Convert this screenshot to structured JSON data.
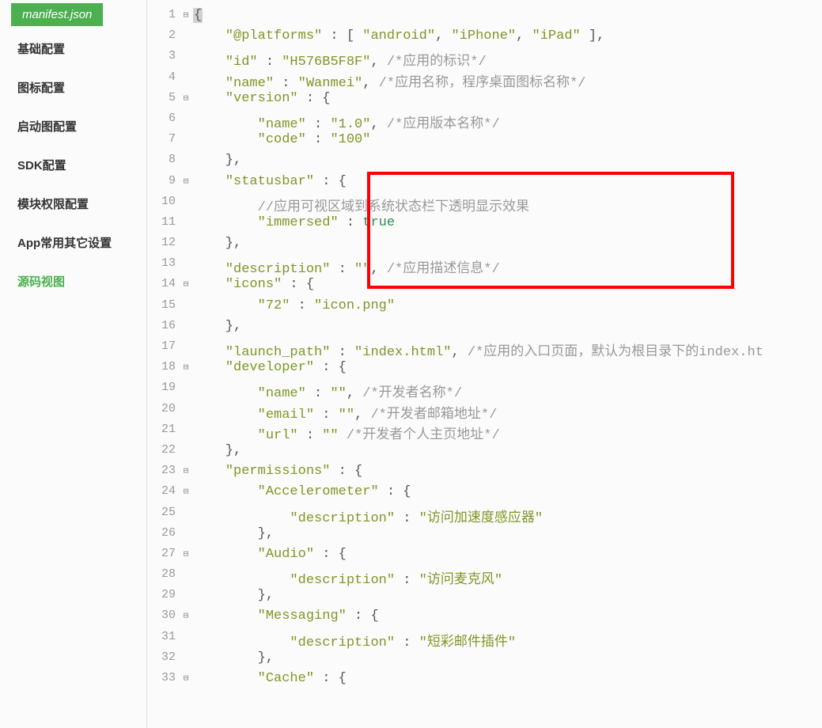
{
  "file_tab": "manifest.json",
  "sidebar": {
    "items": [
      "基础配置",
      "图标配置",
      "启动图配置",
      "SDK配置",
      "模块权限配置",
      "App常用其它设置",
      "源码视图"
    ]
  },
  "code": {
    "lines": [
      {
        "no": 1,
        "fold": "⊟",
        "tokens": [
          {
            "t": "{",
            "c": "punc hl"
          }
        ]
      },
      {
        "no": 2,
        "fold": "",
        "tokens": [
          {
            "t": "    ",
            "c": ""
          },
          {
            "t": "\"@platforms\"",
            "c": "str"
          },
          {
            "t": " : [ ",
            "c": "punc"
          },
          {
            "t": "\"android\"",
            "c": "str"
          },
          {
            "t": ", ",
            "c": "punc"
          },
          {
            "t": "\"iPhone\"",
            "c": "str"
          },
          {
            "t": ", ",
            "c": "punc"
          },
          {
            "t": "\"iPad\"",
            "c": "str"
          },
          {
            "t": " ],",
            "c": "punc"
          }
        ]
      },
      {
        "no": 3,
        "fold": "",
        "tokens": [
          {
            "t": "    ",
            "c": ""
          },
          {
            "t": "\"id\"",
            "c": "str"
          },
          {
            "t": " : ",
            "c": "punc"
          },
          {
            "t": "\"H576B5F8F\"",
            "c": "str"
          },
          {
            "t": ", ",
            "c": "punc"
          },
          {
            "t": "/*应用的标识*/",
            "c": "comment"
          }
        ]
      },
      {
        "no": 4,
        "fold": "",
        "tokens": [
          {
            "t": "    ",
            "c": ""
          },
          {
            "t": "\"name\"",
            "c": "str"
          },
          {
            "t": " : ",
            "c": "punc"
          },
          {
            "t": "\"Wanmei\"",
            "c": "str"
          },
          {
            "t": ", ",
            "c": "punc"
          },
          {
            "t": "/*应用名称，程序桌面图标名称*/",
            "c": "comment"
          }
        ]
      },
      {
        "no": 5,
        "fold": "⊟",
        "tokens": [
          {
            "t": "    ",
            "c": ""
          },
          {
            "t": "\"version\"",
            "c": "str"
          },
          {
            "t": " : {",
            "c": "punc"
          }
        ]
      },
      {
        "no": 6,
        "fold": "",
        "tokens": [
          {
            "t": "        ",
            "c": ""
          },
          {
            "t": "\"name\"",
            "c": "str"
          },
          {
            "t": " : ",
            "c": "punc"
          },
          {
            "t": "\"1.0\"",
            "c": "str"
          },
          {
            "t": ", ",
            "c": "punc"
          },
          {
            "t": "/*应用版本名称*/",
            "c": "comment"
          }
        ]
      },
      {
        "no": 7,
        "fold": "",
        "tokens": [
          {
            "t": "        ",
            "c": ""
          },
          {
            "t": "\"code\"",
            "c": "str"
          },
          {
            "t": " : ",
            "c": "punc"
          },
          {
            "t": "\"100\"",
            "c": "str"
          }
        ]
      },
      {
        "no": 8,
        "fold": "",
        "tokens": [
          {
            "t": "    },",
            "c": "punc"
          }
        ]
      },
      {
        "no": 9,
        "fold": "⊟",
        "tokens": [
          {
            "t": "    ",
            "c": ""
          },
          {
            "t": "\"statusbar\"",
            "c": "str"
          },
          {
            "t": " : {",
            "c": "punc"
          }
        ]
      },
      {
        "no": 10,
        "fold": "",
        "tokens": [
          {
            "t": "        ",
            "c": ""
          },
          {
            "t": "//应用可视区域到系统状态栏下透明显示效果",
            "c": "comment"
          }
        ]
      },
      {
        "no": 11,
        "fold": "",
        "tokens": [
          {
            "t": "        ",
            "c": ""
          },
          {
            "t": "\"immersed\"",
            "c": "str"
          },
          {
            "t": " : ",
            "c": "punc"
          },
          {
            "t": "true",
            "c": "bool"
          }
        ]
      },
      {
        "no": 12,
        "fold": "",
        "tokens": [
          {
            "t": "    },",
            "c": "punc"
          }
        ]
      },
      {
        "no": 13,
        "fold": "",
        "tokens": [
          {
            "t": "    ",
            "c": ""
          },
          {
            "t": "\"description\"",
            "c": "str"
          },
          {
            "t": " : ",
            "c": "punc"
          },
          {
            "t": "\"\"",
            "c": "str"
          },
          {
            "t": ", ",
            "c": "punc"
          },
          {
            "t": "/*应用描述信息*/",
            "c": "comment"
          }
        ]
      },
      {
        "no": 14,
        "fold": "⊟",
        "tokens": [
          {
            "t": "    ",
            "c": ""
          },
          {
            "t": "\"icons\"",
            "c": "str"
          },
          {
            "t": " : {",
            "c": "punc"
          }
        ]
      },
      {
        "no": 15,
        "fold": "",
        "tokens": [
          {
            "t": "        ",
            "c": ""
          },
          {
            "t": "\"72\"",
            "c": "str"
          },
          {
            "t": " : ",
            "c": "punc"
          },
          {
            "t": "\"icon.png\"",
            "c": "str"
          }
        ]
      },
      {
        "no": 16,
        "fold": "",
        "tokens": [
          {
            "t": "    },",
            "c": "punc"
          }
        ]
      },
      {
        "no": 17,
        "fold": "",
        "tokens": [
          {
            "t": "    ",
            "c": ""
          },
          {
            "t": "\"launch_path\"",
            "c": "str"
          },
          {
            "t": " : ",
            "c": "punc"
          },
          {
            "t": "\"index.html\"",
            "c": "str"
          },
          {
            "t": ", ",
            "c": "punc"
          },
          {
            "t": "/*应用的入口页面，默认为根目录下的index.ht",
            "c": "comment"
          }
        ]
      },
      {
        "no": 18,
        "fold": "⊟",
        "tokens": [
          {
            "t": "    ",
            "c": ""
          },
          {
            "t": "\"developer\"",
            "c": "str"
          },
          {
            "t": " : {",
            "c": "punc"
          }
        ]
      },
      {
        "no": 19,
        "fold": "",
        "tokens": [
          {
            "t": "        ",
            "c": ""
          },
          {
            "t": "\"name\"",
            "c": "str"
          },
          {
            "t": " : ",
            "c": "punc"
          },
          {
            "t": "\"\"",
            "c": "str"
          },
          {
            "t": ", ",
            "c": "punc"
          },
          {
            "t": "/*开发者名称*/",
            "c": "comment"
          }
        ]
      },
      {
        "no": 20,
        "fold": "",
        "tokens": [
          {
            "t": "        ",
            "c": ""
          },
          {
            "t": "\"email\"",
            "c": "str"
          },
          {
            "t": " : ",
            "c": "punc"
          },
          {
            "t": "\"\"",
            "c": "str"
          },
          {
            "t": ", ",
            "c": "punc"
          },
          {
            "t": "/*开发者邮箱地址*/",
            "c": "comment"
          }
        ]
      },
      {
        "no": 21,
        "fold": "",
        "tokens": [
          {
            "t": "        ",
            "c": ""
          },
          {
            "t": "\"url\"",
            "c": "str"
          },
          {
            "t": " : ",
            "c": "punc"
          },
          {
            "t": "\"\"",
            "c": "str"
          },
          {
            "t": " ",
            "c": "punc"
          },
          {
            "t": "/*开发者个人主页地址*/",
            "c": "comment"
          }
        ]
      },
      {
        "no": 22,
        "fold": "",
        "tokens": [
          {
            "t": "    },",
            "c": "punc"
          }
        ]
      },
      {
        "no": 23,
        "fold": "⊟",
        "tokens": [
          {
            "t": "    ",
            "c": ""
          },
          {
            "t": "\"permissions\"",
            "c": "str"
          },
          {
            "t": " : {",
            "c": "punc"
          }
        ]
      },
      {
        "no": 24,
        "fold": "⊟",
        "tokens": [
          {
            "t": "        ",
            "c": ""
          },
          {
            "t": "\"Accelerometer\"",
            "c": "str"
          },
          {
            "t": " : {",
            "c": "punc"
          }
        ]
      },
      {
        "no": 25,
        "fold": "",
        "tokens": [
          {
            "t": "            ",
            "c": ""
          },
          {
            "t": "\"description\"",
            "c": "str"
          },
          {
            "t": " : ",
            "c": "punc"
          },
          {
            "t": "\"访问加速度感应器\"",
            "c": "str"
          }
        ]
      },
      {
        "no": 26,
        "fold": "",
        "tokens": [
          {
            "t": "        },",
            "c": "punc"
          }
        ]
      },
      {
        "no": 27,
        "fold": "⊟",
        "tokens": [
          {
            "t": "        ",
            "c": ""
          },
          {
            "t": "\"Audio\"",
            "c": "str"
          },
          {
            "t": " : {",
            "c": "punc"
          }
        ]
      },
      {
        "no": 28,
        "fold": "",
        "tokens": [
          {
            "t": "            ",
            "c": ""
          },
          {
            "t": "\"description\"",
            "c": "str"
          },
          {
            "t": " : ",
            "c": "punc"
          },
          {
            "t": "\"访问麦克风\"",
            "c": "str"
          }
        ]
      },
      {
        "no": 29,
        "fold": "",
        "tokens": [
          {
            "t": "        },",
            "c": "punc"
          }
        ]
      },
      {
        "no": 30,
        "fold": "⊟",
        "tokens": [
          {
            "t": "        ",
            "c": ""
          },
          {
            "t": "\"Messaging\"",
            "c": "str"
          },
          {
            "t": " : {",
            "c": "punc"
          }
        ]
      },
      {
        "no": 31,
        "fold": "",
        "tokens": [
          {
            "t": "            ",
            "c": ""
          },
          {
            "t": "\"description\"",
            "c": "str"
          },
          {
            "t": " : ",
            "c": "punc"
          },
          {
            "t": "\"短彩邮件插件\"",
            "c": "str"
          }
        ]
      },
      {
        "no": 32,
        "fold": "",
        "tokens": [
          {
            "t": "        },",
            "c": "punc"
          }
        ]
      },
      {
        "no": 33,
        "fold": "⊟",
        "tokens": [
          {
            "t": "        ",
            "c": ""
          },
          {
            "t": "\"Cache\"",
            "c": "str"
          },
          {
            "t": " : {",
            "c": "punc"
          }
        ]
      }
    ]
  }
}
